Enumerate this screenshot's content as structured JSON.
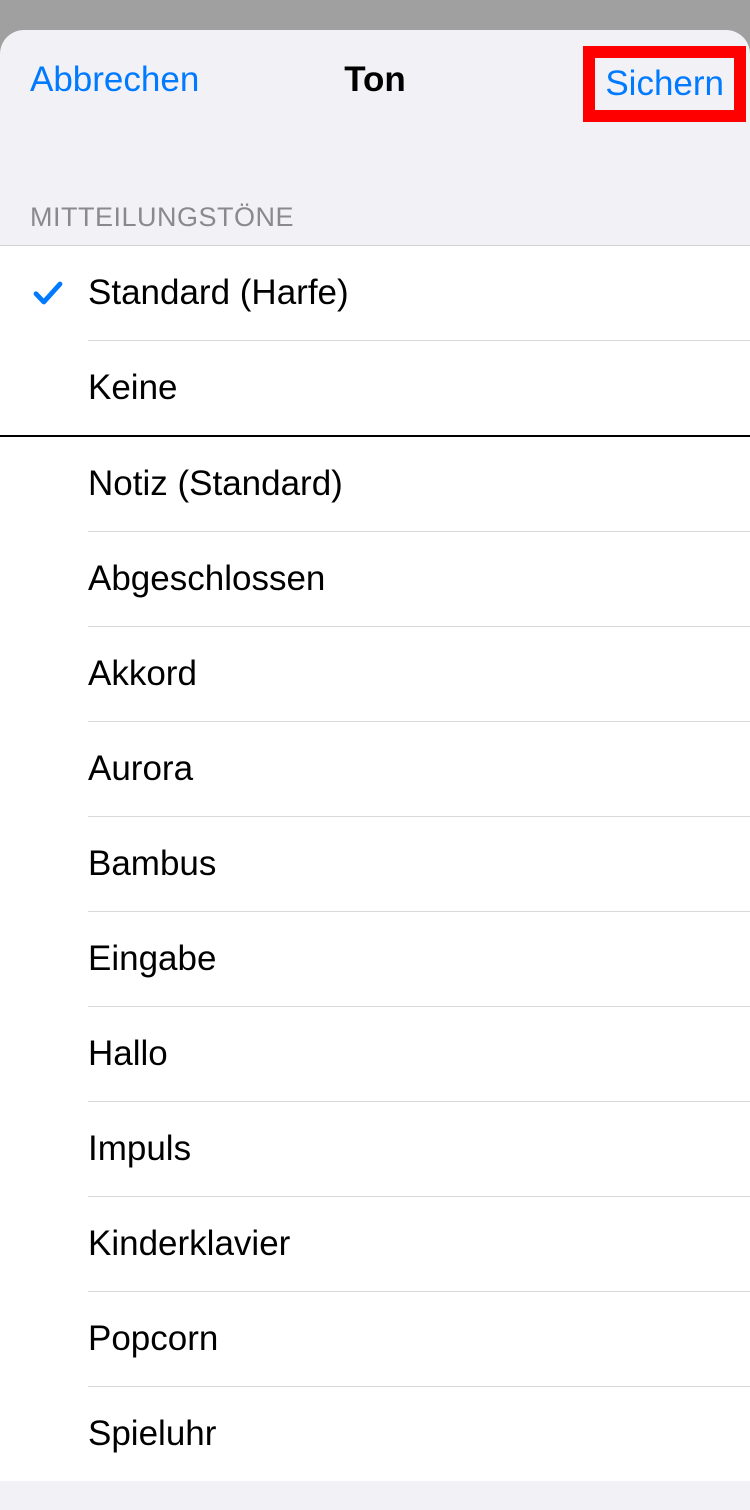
{
  "nav": {
    "cancel": "Abbrechen",
    "title": "Ton",
    "save": "Sichern"
  },
  "section_header": "Mitteilungstöne",
  "selected_index": 0,
  "group1": [
    "Standard (Harfe)",
    "Keine"
  ],
  "group2": [
    "Notiz (Standard)",
    "Abgeschlossen",
    "Akkord",
    "Aurora",
    "Bambus",
    "Eingabe",
    "Hallo",
    "Impuls",
    "Kinderklavier",
    "Popcorn",
    "Spieluhr"
  ],
  "colors": {
    "accent": "#007aff",
    "highlight_box": "#ff0000"
  }
}
